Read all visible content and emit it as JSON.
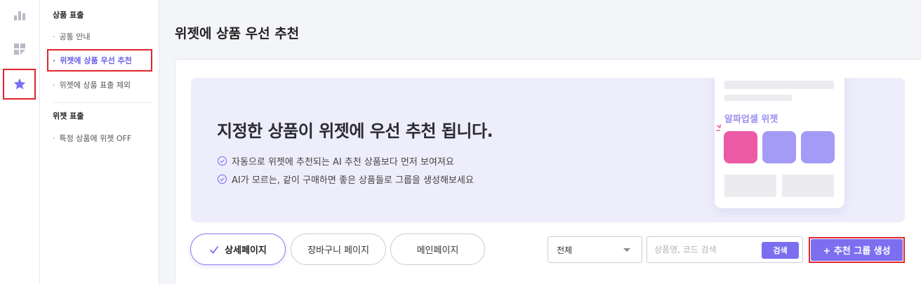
{
  "colors": {
    "accent": "#7b6ff0",
    "highlight_border": "#e0262c",
    "banner_bg": "#eeedfb",
    "pink": "#ec5aa5"
  },
  "rail": {
    "icons": [
      "bar-chart-icon",
      "dashboard-icon",
      "star-icon"
    ],
    "active": "star-icon"
  },
  "submenu": {
    "sections": [
      {
        "title": "상품 표출",
        "items": [
          "공통 안내",
          "위젯에 상품 우선 추천",
          "위젯에 상품 표출 제외"
        ]
      },
      {
        "title": "위젯 표출",
        "items": [
          "특정 상품에 위젯 OFF"
        ]
      }
    ],
    "active_item": "위젯에 상품 우선 추천"
  },
  "page": {
    "title": "위젯에 상품 우선 추천"
  },
  "banner": {
    "heading": "지정한 상품이 위젯에 우선 추천 됩니다.",
    "bullets": [
      "자동으로 위젯에 추천되는 AI 추천 상품보다 먼저 보여져요",
      "AI가 모르는, 같이 구매하면 좋은 상품들로 그룹을 생성해보세요"
    ],
    "illustration_title": "알파업셀 위젯"
  },
  "tabs": [
    {
      "label": "상세페이지",
      "active": true
    },
    {
      "label": "장바구니 페이지",
      "active": false
    },
    {
      "label": "메인페이지",
      "active": false
    }
  ],
  "filter": {
    "selected": "전체"
  },
  "search": {
    "placeholder": "상품명, 코드 검색",
    "button": "검색"
  },
  "create_button": "+ 추천 그룹 생성"
}
